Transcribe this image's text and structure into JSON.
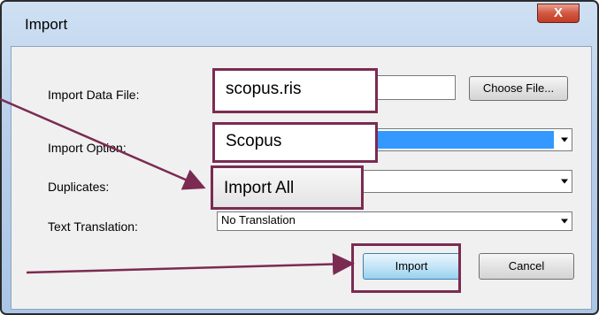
{
  "window": {
    "title": "Import",
    "close_label": "X"
  },
  "form": {
    "import_data_file_label": "Import Data File:",
    "import_data_file_value": "scopus.ris",
    "choose_file_label": "Choose File...",
    "import_option_label": "Import Option:",
    "import_option_value": "Scopus",
    "duplicates_label": "Duplicates:",
    "duplicates_value": "Import All",
    "text_translation_label": "Text Translation:",
    "text_translation_value": "No Translation"
  },
  "buttons": {
    "import": "Import",
    "cancel": "Cancel"
  },
  "colors": {
    "highlight": "#7b2b52",
    "selection": "#3399ff"
  }
}
